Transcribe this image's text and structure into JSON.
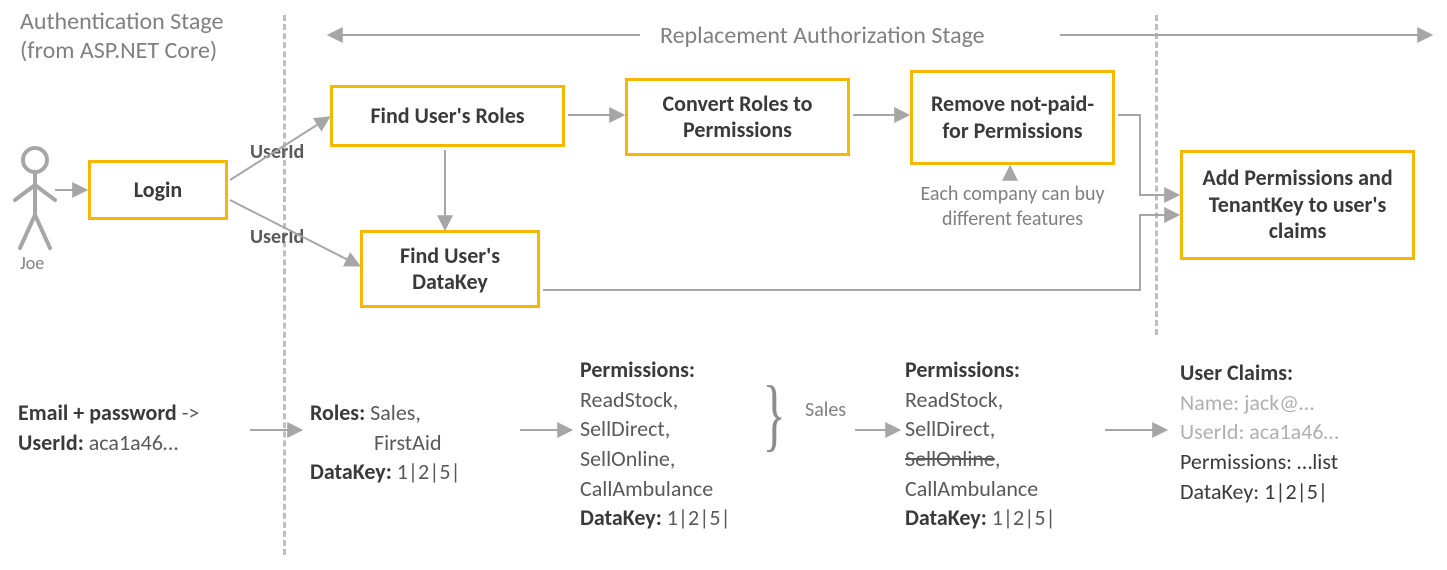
{
  "stages": {
    "auth_line1": "Authentication Stage",
    "auth_line2": "(from ASP.NET Core)",
    "replacement": "Replacement Authorization Stage"
  },
  "actor": {
    "name": "Joe"
  },
  "boxes": {
    "login": "Login",
    "find_roles": "Find User's Roles",
    "convert": "Convert Roles to Permissions",
    "remove": "Remove not-paid-for Permissions",
    "find_datakey": "Find User's DataKey",
    "add_claims": "Add Permissions and TenantKey to user's claims"
  },
  "labels": {
    "userid_top": "UserId",
    "userid_bottom": "UserId",
    "each_company": "Each company can buy different features",
    "sales_brace": "Sales"
  },
  "blocks": {
    "login": {
      "line1_a": "Email + password",
      "line1_b": " ->",
      "line2_a": "UserId:",
      "line2_b": " aca1a46…"
    },
    "roles": {
      "roles_label": "Roles:",
      "roles_vals": " Sales,",
      "roles_vals2": "FirstAid",
      "datakey_label": "DataKey:",
      "datakey_val": " 1|2|5|"
    },
    "perms1": {
      "label": "Permissions:",
      "p1": "ReadStock,",
      "p2": "SellDirect,",
      "p3": "SellOnline,",
      "p4": "CallAmbulance",
      "dk_label": "DataKey:",
      "dk_val": " 1|2|5|"
    },
    "perms2": {
      "label": "Permissions:",
      "p1": "ReadStock,",
      "p2": "SellDirect,",
      "p3_strike": "SellOnline",
      "p3_comma": ",",
      "p4": "CallAmbulance",
      "dk_label": "DataKey:",
      "dk_val": " 1|2|5|"
    },
    "claims": {
      "title": "User Claims:",
      "name": "Name: jack@…",
      "userid": "UserId: aca1a46…",
      "perms_label": "Permissions:",
      "perms_val": " …list",
      "dk_label": "DataKey:",
      "dk_val": " 1|2|5|"
    }
  }
}
